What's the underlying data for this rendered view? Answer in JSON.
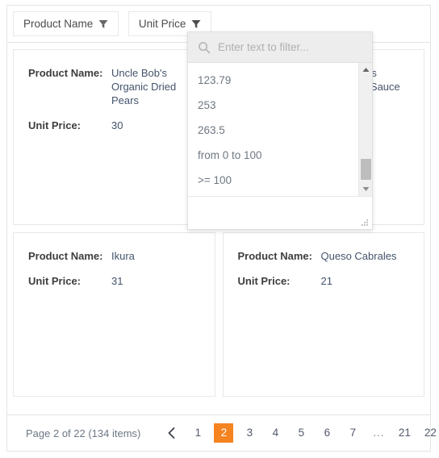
{
  "toolbar": {
    "filters": [
      {
        "label": "Product Name",
        "icon": "funnel-icon"
      },
      {
        "label": "Unit Price",
        "icon": "funnel-icon"
      }
    ]
  },
  "cards": {
    "labels": {
      "product_name": "Product Name:",
      "unit_price": "Unit Price:"
    },
    "items": [
      {
        "product_name": "Uncle Bob's Organic Dried Pears",
        "unit_price": "30"
      },
      {
        "product_name": "Northwoods Cranberry Sauce",
        "unit_price": ""
      },
      {
        "product_name": "Ikura",
        "unit_price": "31"
      },
      {
        "product_name": "Queso Cabrales",
        "unit_price": "21"
      }
    ]
  },
  "filter_popup": {
    "search": {
      "value": "",
      "placeholder": "Enter text to filter...",
      "icon": "search-icon"
    },
    "options": [
      "123.79",
      "253",
      "263.5",
      "from 0 to 100",
      ">= 100"
    ],
    "scrollbar": {
      "up_icon": "caret-up-icon",
      "down_icon": "caret-down-icon"
    },
    "resize_grip_icon": "resize-grip-icon"
  },
  "pager": {
    "info": "Page 2 of 22 (134 items)",
    "prev_icon": "chevron-left-icon",
    "next_icon": "chevron-right-icon",
    "pages": [
      "1",
      "2",
      "3",
      "4",
      "5",
      "6",
      "7",
      "...",
      "21",
      "22"
    ],
    "selected": "2",
    "accent_color": "#f58320"
  }
}
